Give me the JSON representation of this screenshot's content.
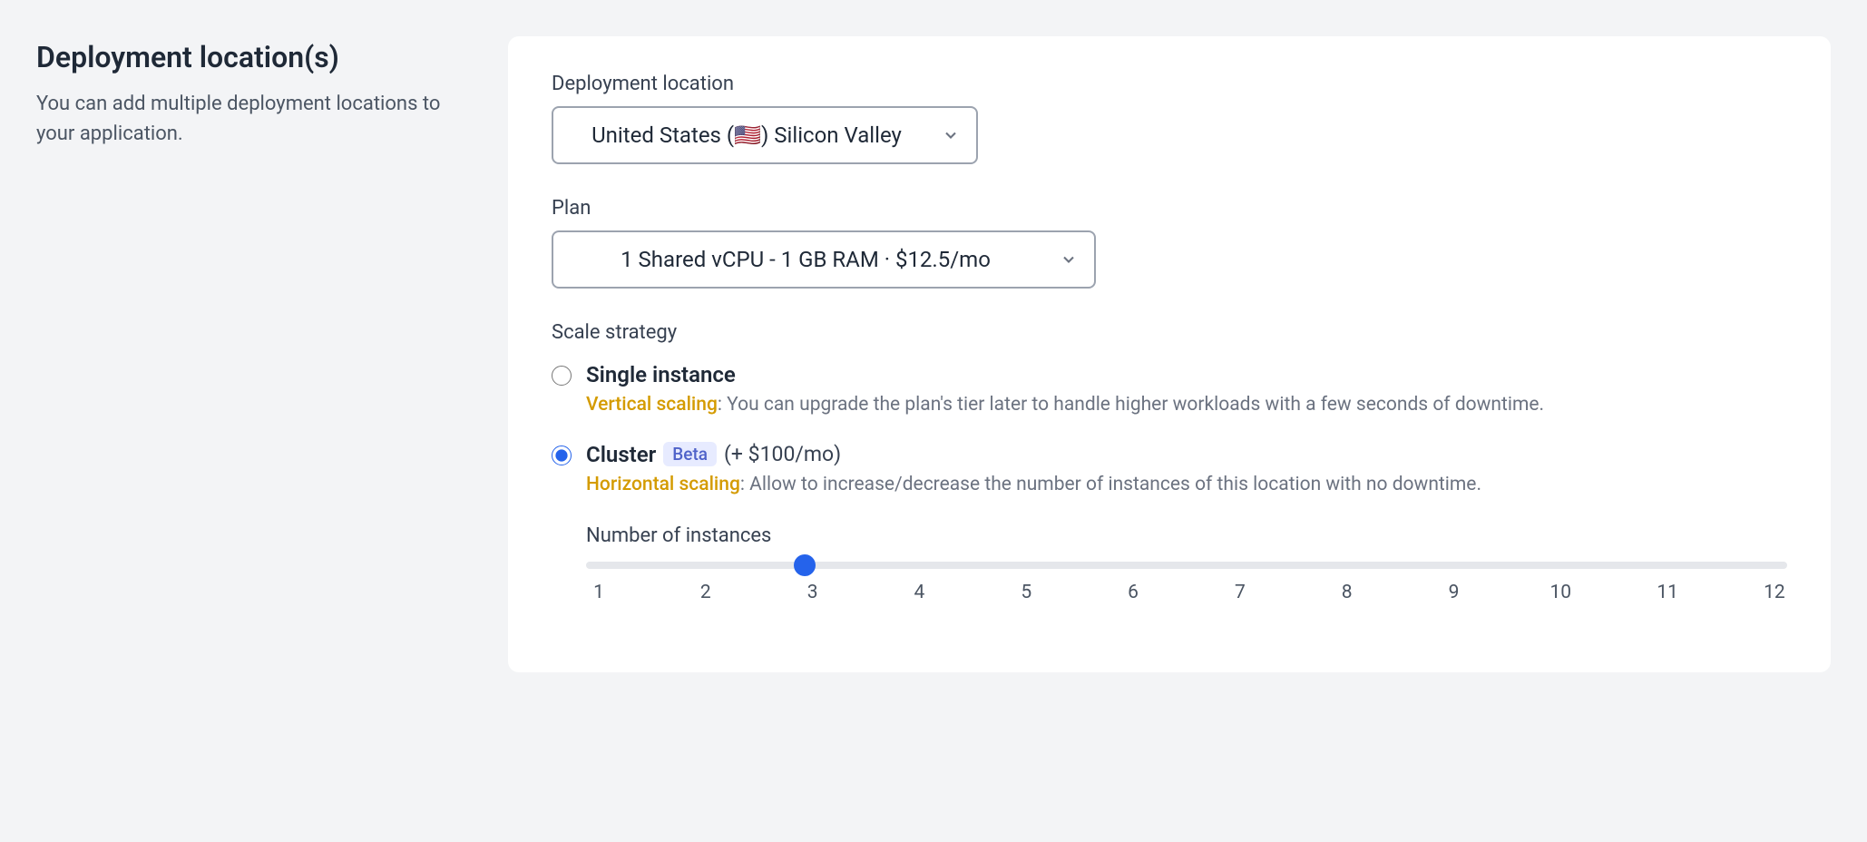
{
  "sidebar": {
    "title": "Deployment location(s)",
    "description": "You can add multiple deployment locations to your application."
  },
  "form": {
    "location": {
      "label": "Deployment location",
      "value": "United States (🇺🇸) Silicon Valley"
    },
    "plan": {
      "label": "Plan",
      "value": "1 Shared vCPU - 1 GB RAM · $12.5/mo"
    },
    "scale": {
      "label": "Scale strategy",
      "single": {
        "title": "Single instance",
        "scaling_term": "Vertical scaling",
        "description": ": You can upgrade the plan's tier later to handle higher workloads with a few seconds of downtime."
      },
      "cluster": {
        "title": "Cluster",
        "badge": "Beta",
        "price": "(+ $100/mo)",
        "scaling_term": "Horizontal scaling",
        "description": ": Allow to increase/decrease the number of instances of this location with no downtime."
      }
    },
    "instances": {
      "label": "Number of instances",
      "value": 3,
      "min": 1,
      "max": 12,
      "ticks": [
        "1",
        "2",
        "3",
        "4",
        "5",
        "6",
        "7",
        "8",
        "9",
        "10",
        "11",
        "12"
      ]
    }
  }
}
